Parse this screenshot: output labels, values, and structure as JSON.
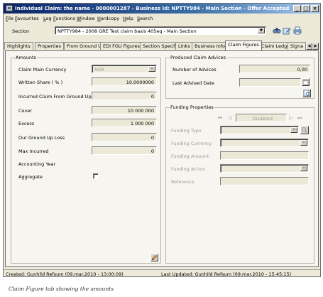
{
  "window": {
    "title": "Individual Claim: the name - 0000001287 - Business Id: NPTTY984 - Main Section - Offer Accepted",
    "controls": [
      "minimize",
      "maximize",
      "close"
    ]
  },
  "menu": [
    "File",
    "Favourites",
    "Log",
    "Functions",
    "Window",
    "Hardcopy",
    "Help",
    "Search"
  ],
  "section": {
    "label": "Section",
    "value": "NPTTY984 - 2008 GRE Test claim basis 405eq - Main Section"
  },
  "toolbar_icons": [
    "search-binoculars-icon",
    "edit-icon",
    "print-icon"
  ],
  "tabs": [
    "Highlights",
    "Properties",
    "From Ground Up",
    "EDI FGU Figures",
    "Section Specific",
    "Links",
    "Business Info",
    "Claim Figures",
    "Claim Ledger",
    "Signa"
  ],
  "active_tab": "Claim Figures",
  "amounts": {
    "title": "Amounts",
    "main_currency_label": "Claim Main Currency",
    "main_currency_value": "NOK",
    "written_share_label": "Written Share ( % )",
    "written_share_value": "10,0000000",
    "incurred_fgu_label": "Incurred Claim From Ground Up",
    "incurred_fgu_value": "0",
    "cover_label": "Cover",
    "cover_value": "10 000 000",
    "excess_label": "Excess",
    "excess_value": "1 000 000",
    "our_fgu_loss_label": "Our Ground Up Loss",
    "our_fgu_loss_value": "0",
    "max_incurred_label": "Max Incurred",
    "max_incurred_value": "0",
    "accounting_year_label": "Accounting Year",
    "accounting_year_value": "",
    "aggregate_label": "Aggregate",
    "aggregate_checked": false
  },
  "produced_advices": {
    "title": "Produced Claim Advices",
    "number_label": "Number of Advices",
    "number_value": "0,00",
    "last_date_label": "Last Advised Date",
    "last_date_value": ""
  },
  "funding": {
    "title": "Funding Properties",
    "nav_status": "Disabled",
    "type_label": "Funding Type",
    "currency_label": "Funding Currency",
    "amount_label": "Funding Amount",
    "action_label": "Funding Action",
    "reference_label": "Reference"
  },
  "status": {
    "created": "Created: Gunhild Refsum (09.mar.2010 - 13:00:09)",
    "updated": "Last Updated: Gunhild Refsum (09.mar.2010 - 15:45:15)"
  },
  "caption": "Claim Figure tab showing the amounts"
}
